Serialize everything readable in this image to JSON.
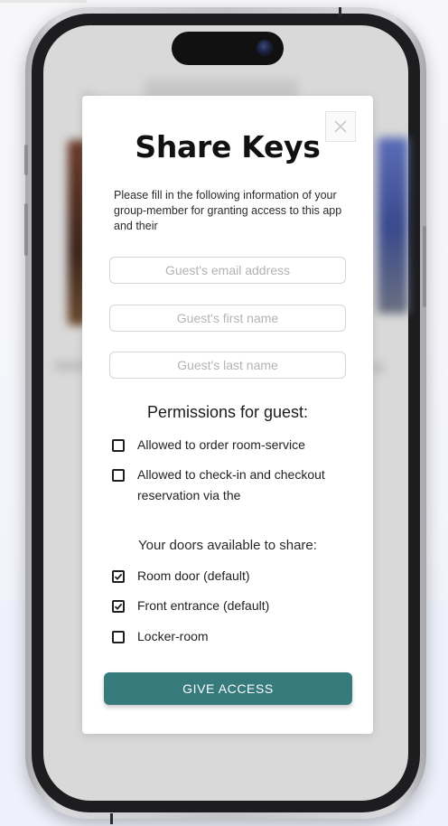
{
  "modal": {
    "title": "Share Keys",
    "intro": "Please fill in the following information of your group-member for granting access to this app and their",
    "close_icon": "close-icon",
    "fields": {
      "email_placeholder": "Guest's email address",
      "email_value": "",
      "first_name_placeholder": "Guest's first name",
      "first_name_value": "",
      "last_name_placeholder": "Guest's last name",
      "last_name_value": ""
    },
    "permissions": {
      "heading": "Permissions for guest:",
      "items": [
        {
          "label": "Allowed to order room-service",
          "checked": false
        },
        {
          "label": "Allowed to check-in and checkout reservation via the",
          "checked": false
        }
      ]
    },
    "doors": {
      "heading": "Your doors available to share:",
      "items": [
        {
          "label": "Room door (default)",
          "checked": true
        },
        {
          "label": "Front entrance (default)",
          "checked": true
        },
        {
          "label": "Locker-room",
          "checked": false
        }
      ]
    },
    "submit_label": "GIVE ACCESS"
  },
  "colors": {
    "accent": "#367a7c",
    "modal_bg": "#ffffff",
    "screen_bg": "#d9d9d9"
  }
}
